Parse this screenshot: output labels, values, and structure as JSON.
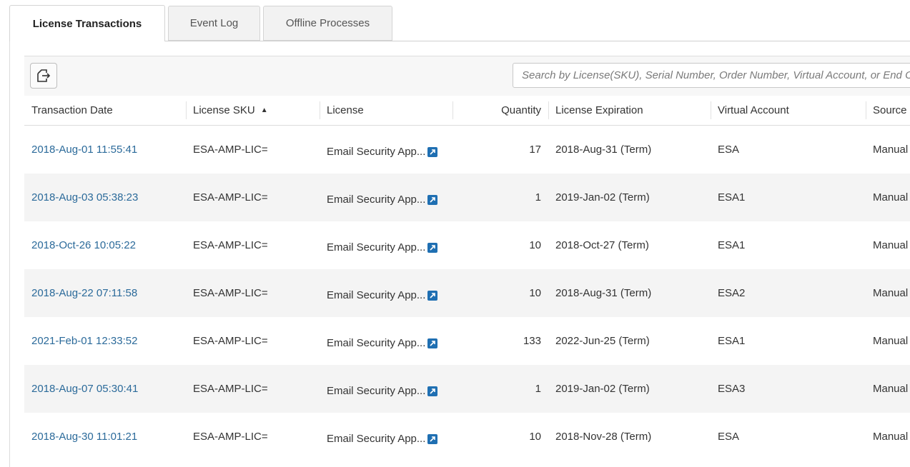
{
  "tabs": [
    {
      "label": "License Transactions",
      "active": true
    },
    {
      "label": "Event Log",
      "active": false
    },
    {
      "label": "Offline Processes",
      "active": false
    }
  ],
  "toolbar": {
    "export_icon": "export-icon",
    "search_placeholder": "Search by License(SKU), Serial Number, Order Number, Virtual Account, or End Customer"
  },
  "table": {
    "columns": [
      {
        "label": "Transaction Date"
      },
      {
        "label": "License SKU",
        "sort": "ascending"
      },
      {
        "label": "License"
      },
      {
        "label": "Quantity"
      },
      {
        "label": "License Expiration"
      },
      {
        "label": "Virtual Account"
      },
      {
        "label": "Source"
      }
    ],
    "rows": [
      {
        "date": "2018-Aug-01 11:55:41",
        "sku": "ESA-AMP-LIC=",
        "license": "Email Security App...",
        "quantity": "17",
        "expiration": "2018-Aug-31 (Term)",
        "account": "ESA",
        "source": "Manual"
      },
      {
        "date": "2018-Aug-03 05:38:23",
        "sku": "ESA-AMP-LIC=",
        "license": "Email Security App...",
        "quantity": "1",
        "expiration": "2019-Jan-02 (Term)",
        "account": "ESA1",
        "source": "Manual"
      },
      {
        "date": "2018-Oct-26 10:05:22",
        "sku": "ESA-AMP-LIC=",
        "license": "Email Security App...",
        "quantity": "10",
        "expiration": "2018-Oct-27 (Term)",
        "account": "ESA1",
        "source": "Manual"
      },
      {
        "date": "2018-Aug-22 07:11:58",
        "sku": "ESA-AMP-LIC=",
        "license": "Email Security App...",
        "quantity": "10",
        "expiration": "2018-Aug-31 (Term)",
        "account": "ESA2",
        "source": "Manual"
      },
      {
        "date": "2021-Feb-01 12:33:52",
        "sku": "ESA-AMP-LIC=",
        "license": "Email Security App...",
        "quantity": "133",
        "expiration": "2022-Jun-25 (Term)",
        "account": "ESA1",
        "source": "Manual"
      },
      {
        "date": "2018-Aug-07 05:30:41",
        "sku": "ESA-AMP-LIC=",
        "license": "Email Security App...",
        "quantity": "1",
        "expiration": "2019-Jan-02 (Term)",
        "account": "ESA3",
        "source": "Manual"
      },
      {
        "date": "2018-Aug-30 11:01:21",
        "sku": "ESA-AMP-LIC=",
        "license": "Email Security App...",
        "quantity": "10",
        "expiration": "2018-Nov-28 (Term)",
        "account": "ESA",
        "source": "Manual"
      }
    ]
  },
  "colors": {
    "link": "#2b6a9a",
    "external_link_icon": "#1f6fb2",
    "row_alt": "#f4f4f4"
  }
}
